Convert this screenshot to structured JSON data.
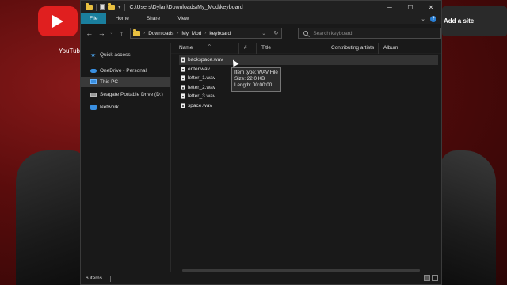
{
  "background": {
    "shortcut_label": "YouTub",
    "add_site_label": "Add a site"
  },
  "window": {
    "title": "C:\\Users\\Dylan\\Downloads\\My_Mod\\keyboard",
    "controls": {
      "minimize": "─",
      "maximize": "☐",
      "close": "✕"
    }
  },
  "ribbon": {
    "tabs": [
      "File",
      "Home",
      "Share",
      "View"
    ],
    "collapse_glyph": "⌄",
    "help_glyph": "?"
  },
  "address_bar": {
    "breadcrumbs": [
      "Downloads",
      "My_Mod",
      "keyboard"
    ],
    "separator": "›"
  },
  "search": {
    "placeholder": "Search keyboard"
  },
  "nav_pane": {
    "items": [
      {
        "label": "Quick access",
        "icon": "star-icon"
      },
      {
        "label": "OneDrive - Personal",
        "icon": "cloud-icon"
      },
      {
        "label": "This PC",
        "icon": "computer-icon",
        "selected": true
      },
      {
        "label": "Seagate Portable Drive (D:)",
        "icon": "drive-icon"
      },
      {
        "label": "Network",
        "icon": "network-icon"
      }
    ]
  },
  "columns": [
    "Name",
    "#",
    "Title",
    "Contributing artists",
    "Album"
  ],
  "files": [
    {
      "name": "backspace.wav",
      "hover": true
    },
    {
      "name": "enter.wav"
    },
    {
      "name": "letter_1.wav"
    },
    {
      "name": "letter_2.wav"
    },
    {
      "name": "letter_3.wav"
    },
    {
      "name": "space.wav"
    }
  ],
  "tooltip": {
    "item_type": "Item type: WAV File",
    "size": "Size: 22.0 KB",
    "length": "Length: 00:00:00"
  },
  "status": {
    "item_count": "6 items"
  },
  "colors": {
    "accent": "#1a7f9e",
    "window_bg": "#191919",
    "hover_bg": "#333333"
  }
}
